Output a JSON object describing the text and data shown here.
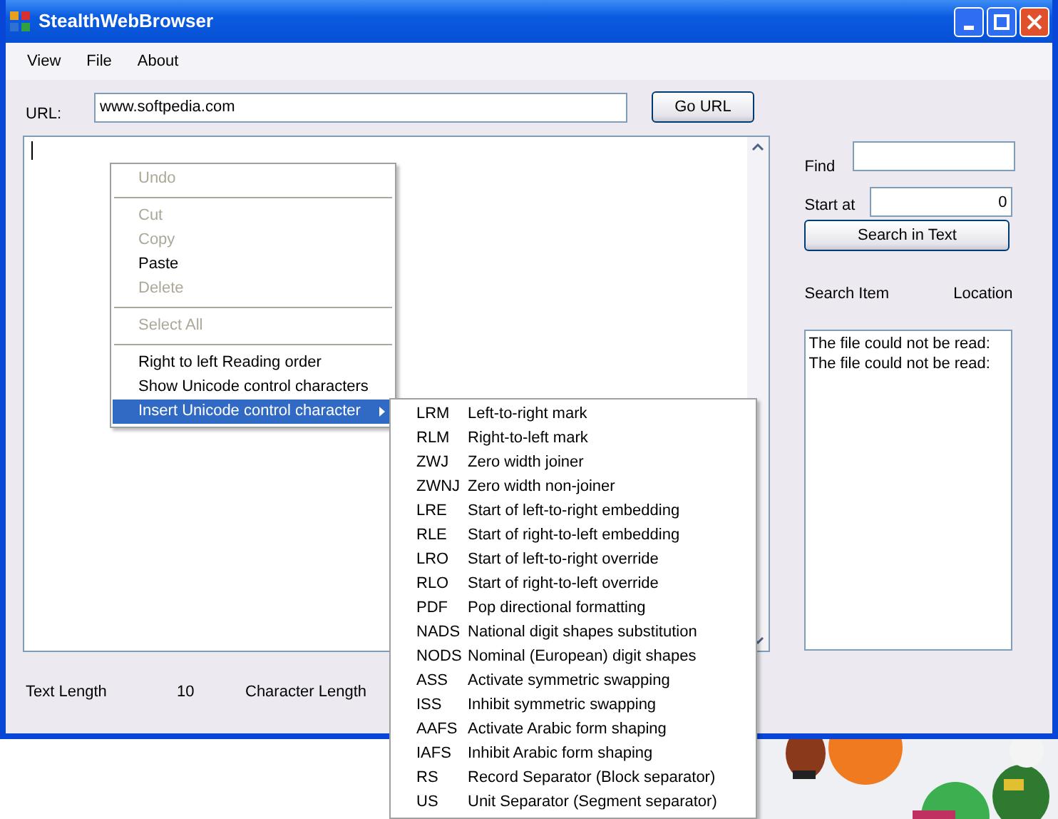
{
  "window": {
    "title": "StealthWebBrowser"
  },
  "menu_bar": [
    "View",
    "File",
    "About"
  ],
  "url": {
    "label": "URL:",
    "value": "www.softpedia.com",
    "button": "Go URL"
  },
  "search": {
    "find_label": "Find",
    "start_label": "Start at",
    "start_value": "0",
    "button": "Search in Text",
    "columns": [
      "Search Item",
      "Location"
    ],
    "results": [
      "The file could not be read:",
      "The file could not be read:"
    ]
  },
  "status": [
    {
      "label": "Text Length",
      "value": "10"
    },
    {
      "label": "Character Length"
    }
  ],
  "context_menu": [
    {
      "kind": "item",
      "label": "Undo",
      "disabled": true,
      "selected": false
    },
    {
      "kind": "separator"
    },
    {
      "kind": "item",
      "label": "Cut",
      "disabled": true,
      "selected": false
    },
    {
      "kind": "item",
      "label": "Copy",
      "disabled": true,
      "selected": false
    },
    {
      "kind": "item",
      "label": "Paste",
      "disabled": false,
      "selected": false
    },
    {
      "kind": "item",
      "label": "Delete",
      "disabled": true,
      "selected": false
    },
    {
      "kind": "separator"
    },
    {
      "kind": "item",
      "label": "Select All",
      "disabled": true,
      "selected": false
    },
    {
      "kind": "separator"
    },
    {
      "kind": "item",
      "label": "Right to left Reading order",
      "disabled": false,
      "selected": false
    },
    {
      "kind": "item",
      "label": "Show Unicode control characters",
      "disabled": false,
      "selected": false
    },
    {
      "kind": "submenu",
      "label": "Insert Unicode control character",
      "disabled": false,
      "selected": true
    }
  ],
  "submenu": [
    {
      "code": "LRM",
      "label": "Left-to-right mark"
    },
    {
      "code": "RLM",
      "label": "Right-to-left mark"
    },
    {
      "code": "ZWJ",
      "label": "Zero width joiner"
    },
    {
      "code": "ZWNJ",
      "label": "Zero width non-joiner"
    },
    {
      "code": "LRE",
      "label": "Start of left-to-right embedding"
    },
    {
      "code": "RLE",
      "label": "Start of right-to-left embedding"
    },
    {
      "code": "LRO",
      "label": "Start of left-to-right override"
    },
    {
      "code": "RLO",
      "label": "Start of right-to-left override"
    },
    {
      "code": "PDF",
      "label": "Pop directional formatting"
    },
    {
      "code": "NADS",
      "label": "National digit shapes substitution"
    },
    {
      "code": "NODS",
      "label": "Nominal (European) digit shapes"
    },
    {
      "code": "ASS",
      "label": "Activate symmetric swapping"
    },
    {
      "code": "ISS",
      "label": "Inhibit symmetric swapping"
    },
    {
      "code": "AAFS",
      "label": "Activate Arabic form shaping"
    },
    {
      "code": "IAFS",
      "label": "Inhibit Arabic form shaping"
    },
    {
      "code": "RS",
      "label": "Record Separator (Block separator)"
    },
    {
      "code": "US",
      "label": "Unit Separator (Segment separator)"
    }
  ]
}
